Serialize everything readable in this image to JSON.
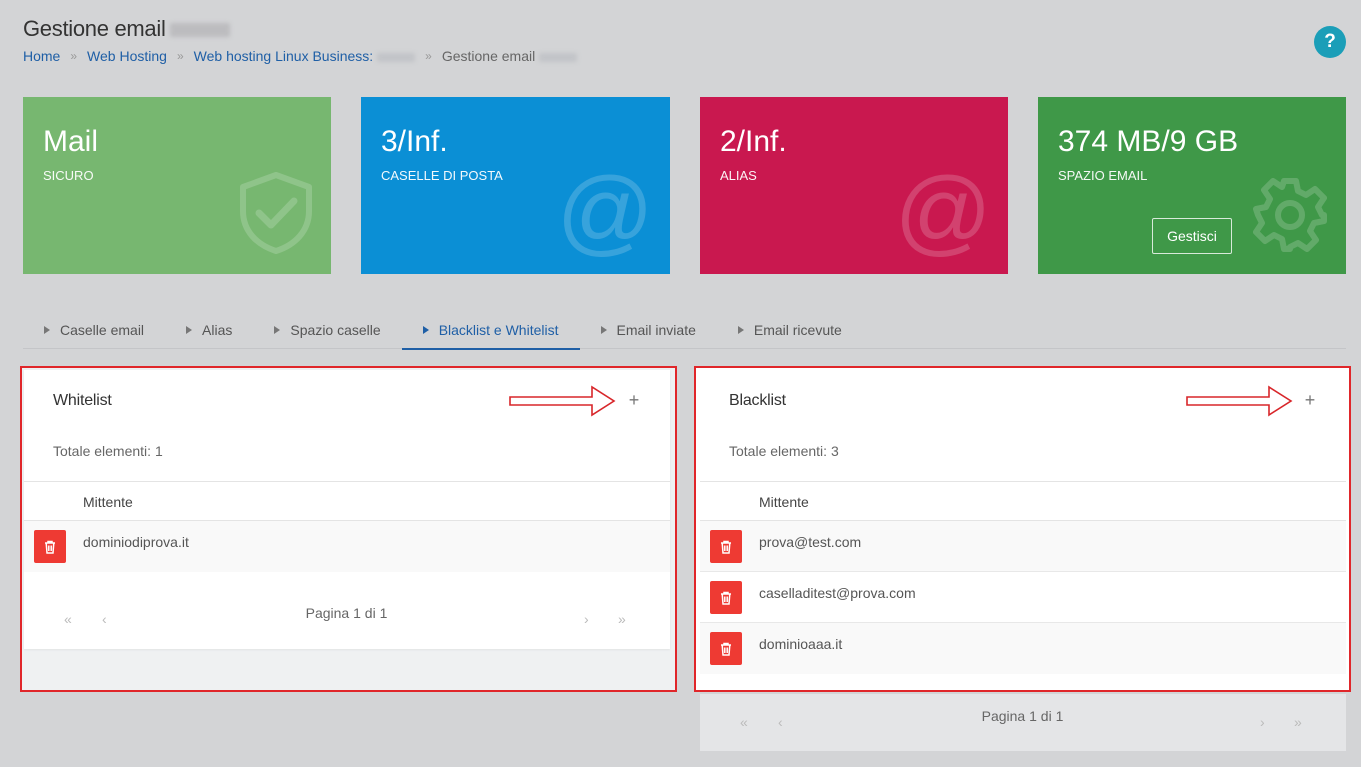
{
  "header": {
    "title": "Gestione email",
    "help_label": "?"
  },
  "breadcrumb": {
    "items": [
      "Home",
      "Web Hosting",
      "Web hosting Linux Business:"
    ],
    "current": "Gestione email",
    "separator": "»"
  },
  "stats": [
    {
      "value": "Mail",
      "label": "SICURO",
      "icon": "shield-check-icon",
      "color": "#77b770"
    },
    {
      "value": "3/Inf.",
      "label": "CASELLE DI POSTA",
      "icon": "at-sign-icon",
      "color": "#0b8fd5"
    },
    {
      "value": "2/Inf.",
      "label": "ALIAS",
      "icon": "at-sign-icon",
      "color": "#c9184f"
    },
    {
      "value": "374 MB/9 GB",
      "label": "SPAZIO EMAIL",
      "icon": "gear-icon",
      "color": "#3f9848",
      "button": "Gestisci"
    }
  ],
  "tabs": [
    {
      "label": "Caselle email",
      "active": false
    },
    {
      "label": "Alias",
      "active": false
    },
    {
      "label": "Spazio caselle",
      "active": false
    },
    {
      "label": "Blacklist e Whitelist",
      "active": true
    },
    {
      "label": "Email inviate",
      "active": false
    },
    {
      "label": "Email ricevute",
      "active": false
    }
  ],
  "whitelist": {
    "title": "Whitelist",
    "add_label": "+",
    "total": "Totale elementi: 1",
    "column": "Mittente",
    "rows": [
      "dominiodiprova.it"
    ],
    "pager": {
      "first": "«",
      "prev": "‹",
      "text": "Pagina 1 di 1",
      "next": "›",
      "last": "»"
    }
  },
  "blacklist": {
    "title": "Blacklist",
    "add_label": "+",
    "total": "Totale elementi: 3",
    "column": "Mittente",
    "rows": [
      "prova@test.com",
      "caselladitest@prova.com",
      "dominioaaa.it"
    ],
    "pager": {
      "first": "«",
      "prev": "‹",
      "text": "Pagina 1 di 1",
      "next": "›",
      "last": "»"
    }
  },
  "colors": {
    "accent": "#1f5fa6",
    "delete": "#ee3a33",
    "highlight_frame": "#e0262a",
    "help": "#1b9eb8"
  }
}
